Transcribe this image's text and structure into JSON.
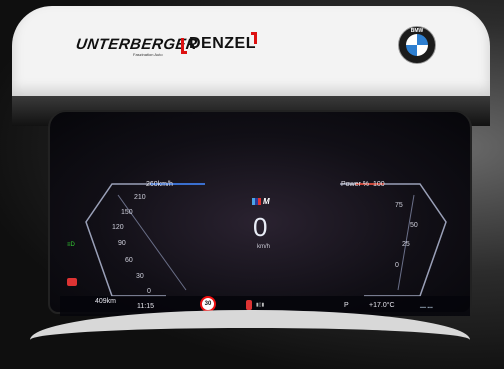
{
  "banner": {
    "dealer1": "UNTERBERGER",
    "dealer1_sub": "Faszination Auto",
    "dealer2": "DENZEL",
    "brand": "BMW"
  },
  "cluster": {
    "speedo_max": "260km/h",
    "speed_ticks": [
      "210",
      "150",
      "120",
      "90",
      "60",
      "30",
      "0"
    ],
    "current_speed": "0",
    "speed_unit": "km/h",
    "power_label": "Power %",
    "power_max": "100",
    "power_ticks": [
      "75",
      "50",
      "25",
      "0"
    ],
    "range": "409km",
    "time": "11:15",
    "speed_limit": "30",
    "gear": "P",
    "temperature": "+17.0°C",
    "mode": "M",
    "colors": {
      "red_warning": "#d33333",
      "blue_accent": "#2e7fd0"
    }
  }
}
